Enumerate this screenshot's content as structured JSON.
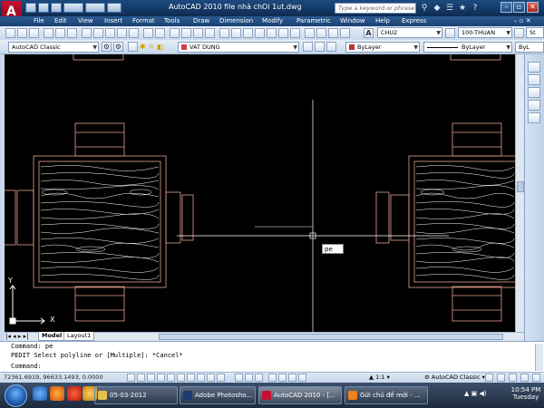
{
  "window": {
    "title": "AutoCAD 2010    file nhà chOi 1ut.dwg",
    "search_placeholder": "Type a keyword or phrase"
  },
  "menu": [
    "File",
    "Edit",
    "View",
    "Insert",
    "Format",
    "Tools",
    "Draw",
    "Dimension",
    "Modify",
    "Parametric",
    "Window",
    "Help",
    "Express"
  ],
  "toolbar1": {
    "text_style": "CHU2",
    "dim_style": "100-THUAN",
    "other_style": "St"
  },
  "toolbar2": {
    "workspace": "AutoCAD Classic",
    "layer": "VAT DUNG",
    "color": "ByLayer",
    "linetype": "ByLayer",
    "lineweight": "ByL"
  },
  "drawing": {
    "cursor_tooltip": "pe",
    "ucs_x": "X",
    "ucs_y": "Y"
  },
  "tabs": [
    "Model",
    "Layout1"
  ],
  "command": {
    "line1": "Command: pe",
    "line2": "PEDIT Select polyline or [Multiple]: *Cancel*",
    "line3": "Command:"
  },
  "status": {
    "coordinates": "72361.6919, 96633.1493, 0.0000",
    "scale": "1:1",
    "workspace": "AutoCAD Classic"
  },
  "taskbar": {
    "items": [
      "05-03-2012",
      "Adobe Photosho...",
      "AutoCAD 2010 - [...",
      "Gửi chủ đề mới - ..."
    ],
    "active_index": 2,
    "time": "10:54 PM",
    "day": "Tuesday"
  },
  "colors": {
    "title_bar": "#1c4a7e",
    "drawing_bg": "#000000",
    "furniture_outline": "#e8a090",
    "wood_grain": "#ffffff",
    "crosshair": "#ffffff"
  }
}
